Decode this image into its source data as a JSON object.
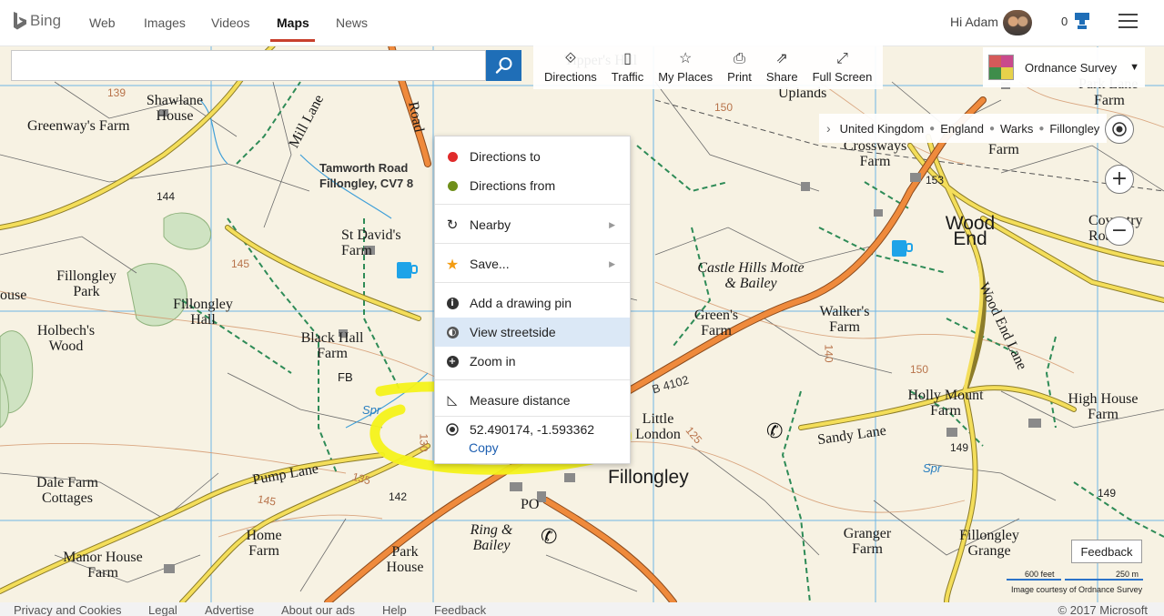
{
  "nav": {
    "brand": "Bing",
    "tabs": [
      {
        "label": "Web"
      },
      {
        "label": "Images"
      },
      {
        "label": "Videos"
      },
      {
        "label": "Maps",
        "active": true
      },
      {
        "label": "News"
      }
    ],
    "greeting": "Hi Adam",
    "rewards_count": "0"
  },
  "search": {
    "value": "",
    "placeholder": ""
  },
  "toolbar": {
    "items": [
      {
        "label": "Directions",
        "icon": "directions-icon"
      },
      {
        "label": "Traffic",
        "icon": "traffic-icon"
      },
      {
        "label": "My Places",
        "icon": "star-icon"
      },
      {
        "label": "Print",
        "icon": "printer-icon"
      },
      {
        "label": "Share",
        "icon": "share-icon"
      },
      {
        "label": "Full Screen",
        "icon": "fullscreen-icon"
      }
    ]
  },
  "layer": {
    "label": "Ordnance Survey"
  },
  "breadcrumb": [
    "United Kingdom",
    "England",
    "Warks",
    "Fillongley"
  ],
  "context_menu": {
    "directions_to": "Directions to",
    "directions_from": "Directions from",
    "nearby": "Nearby",
    "save": "Save...",
    "add_pin": "Add a drawing pin",
    "streetside": "View streetside",
    "zoom_in": "Zoom in",
    "measure": "Measure distance",
    "coordinates": "52.490174, -1.593362",
    "copy": "Copy"
  },
  "map": {
    "labels": [
      "Greenway's Farm",
      "Shawlane House",
      "Mill Lane",
      "Tamworth Road Fillongley, CV7 8",
      "Road",
      "St David's Farm",
      "Fillongley Park",
      "Fillongley Hall",
      "Holbech's Wood",
      "Black Hall Farm",
      "FB",
      "Dale Farm Cottages",
      "Pump Lane",
      "Home Farm",
      "Manor House Farm",
      "Park House",
      "Ring & Bailey",
      "PO",
      "Fillongley",
      "Little London",
      "B 4102",
      "Castle Hills Motte & Bailey",
      "Green's Farm",
      "Walker's Farm",
      "Crossways Farm",
      "Wood End",
      "Wood End Lane",
      "Holly Mount Farm",
      "Sandy Lane",
      "High House Farm",
      "Granger Farm",
      "Fillongley Grange",
      "Uplands",
      "Tipper's Hill",
      "Park Lane",
      "Farm",
      "Farm",
      "Coventry Road",
      "ouse",
      "Spr",
      "Spr"
    ],
    "heights": [
      "139",
      "144",
      "145",
      "150",
      "153",
      "140",
      "142",
      "135",
      "145",
      "149",
      "149",
      "150",
      "125",
      "130"
    ]
  },
  "map_ui": {
    "feedback": "Feedback",
    "scale_feet": "600 feet",
    "scale_meters": "250 m",
    "credit": "Image courtesy of Ordnance Survey"
  },
  "footer": {
    "links": [
      "Privacy and Cookies",
      "Legal",
      "Advertise",
      "About our ads",
      "Help",
      "Feedback"
    ],
    "copyright": "© 2017 Microsoft"
  },
  "colors": {
    "accent_underline": "#c8402d",
    "search_button": "#1f6eb7",
    "highlight_stroke": "#f4f21a",
    "directions_to_dot": "#e02b2b",
    "directions_from_dot": "#6f8f1a",
    "save_star": "#f39c12"
  }
}
